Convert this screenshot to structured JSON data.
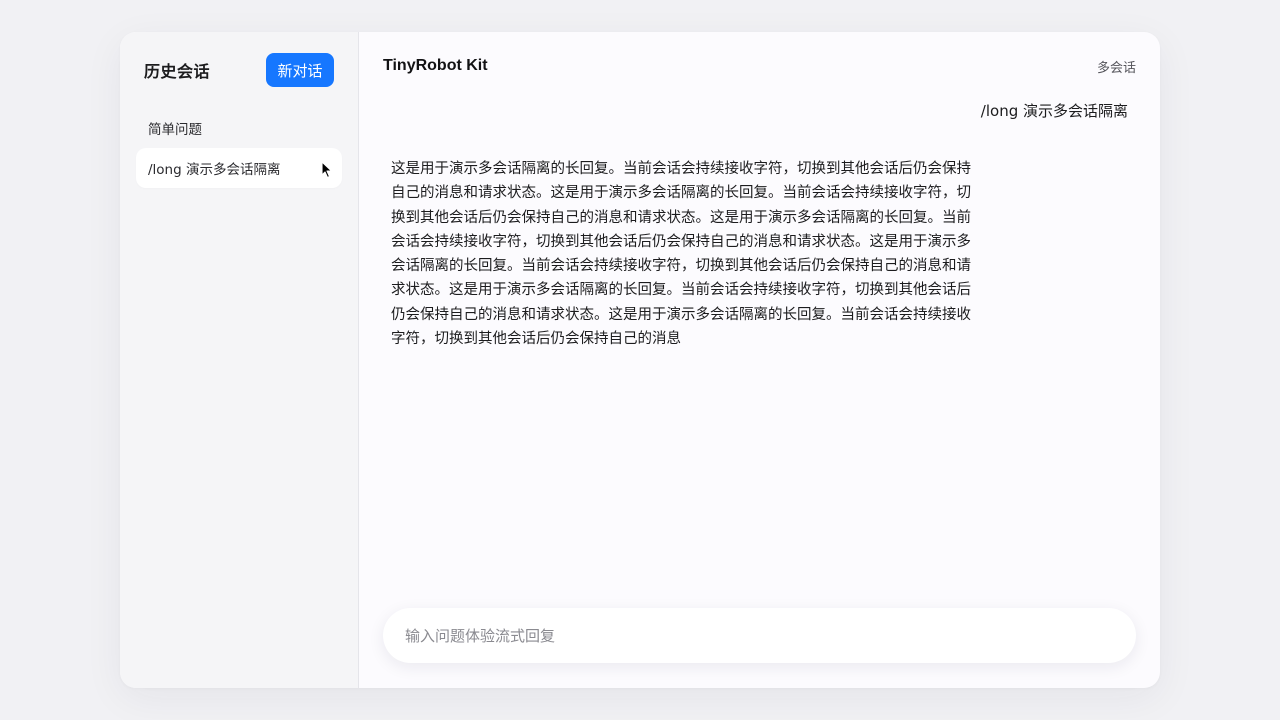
{
  "sidebar": {
    "title": "历史会话",
    "new_chat_label": "新对话",
    "sessions": [
      {
        "label": "简单问题",
        "active": false
      },
      {
        "label": "/long 演示多会话隔离",
        "active": true
      }
    ]
  },
  "header": {
    "title": "TinyRobot Kit",
    "mode_label": "多会话"
  },
  "conversation": {
    "user_message": "/long 演示多会话隔离",
    "bot_message": "这是用于演示多会话隔离的长回复。当前会话会持续接收字符，切换到其他会话后仍会保持自己的消息和请求状态。这是用于演示多会话隔离的长回复。当前会话会持续接收字符，切换到其他会话后仍会保持自己的消息和请求状态。这是用于演示多会话隔离的长回复。当前会话会持续接收字符，切换到其他会话后仍会保持自己的消息和请求状态。这是用于演示多会话隔离的长回复。当前会话会持续接收字符，切换到其他会话后仍会保持自己的消息和请求状态。这是用于演示多会话隔离的长回复。当前会话会持续接收字符，切换到其他会话后仍会保持自己的消息和请求状态。这是用于演示多会话隔离的长回复。当前会话会持续接收字符，切换到其他会话后仍会保持自己的消息"
  },
  "input": {
    "placeholder": "输入问题体验流式回复",
    "value": ""
  },
  "colors": {
    "accent": "#1677ff",
    "background": "#f1f1f4",
    "panel": "#fcfbfe",
    "sidebar": "#f5f5f7"
  },
  "icons": {
    "cursor": "mouse-pointer-icon"
  }
}
